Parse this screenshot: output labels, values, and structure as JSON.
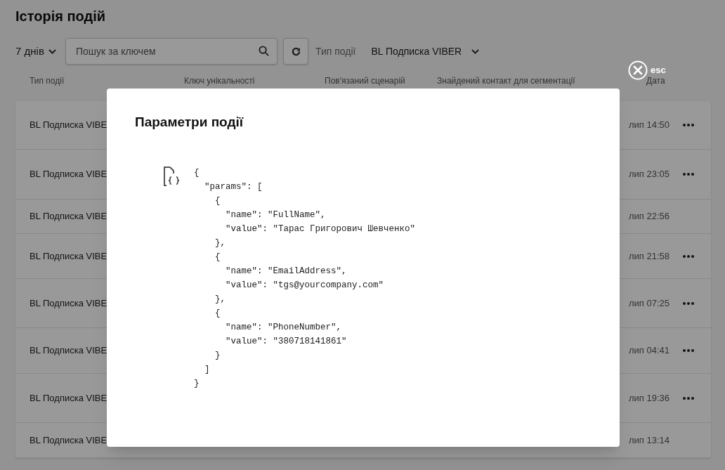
{
  "page": {
    "title": "Історія подій"
  },
  "toolbar": {
    "period": "7 днів",
    "search": {
      "placeholder": "Пошук за ключем"
    },
    "event_type_label": "Тип події",
    "event_type_value": "BL Подписка VIBER"
  },
  "table": {
    "columns": [
      "Тип події",
      "Ключ унікальності",
      "Пов'язаний сценарій",
      "Знайдений контакт для сегментації",
      "Дата"
    ],
    "rows": [
      {
        "event_type": "BL Подписка VIBE",
        "date": "лип 14:50",
        "menu": true
      },
      {
        "event_type": "BL Подписка VIBE",
        "date": "лип 23:05",
        "menu": true
      },
      {
        "event_type": "BL Подписка VIBE",
        "date": "лип 22:56",
        "menu": false
      },
      {
        "event_type": "BL Подписка VIBE",
        "date": "лип 21:58",
        "menu": true
      },
      {
        "event_type": "BL Подписка VIBE",
        "date": "лип 07:25",
        "menu": true
      },
      {
        "event_type": "BL Подписка VIBE",
        "date": "лип 04:41",
        "menu": true
      },
      {
        "event_type": "BL Подписка VIBE",
        "date": "лип 19:36",
        "menu": true
      },
      {
        "event_type": "BL Подписка VIBE",
        "date": "лип 13:14",
        "menu": false
      }
    ]
  },
  "modal": {
    "title": "Параметри події",
    "close_label": "esc",
    "json": "{\n  \"params\": [\n    {\n      \"name\": \"FullName\",\n      \"value\": \"Тарас Григорович Шевченко\"\n    },\n    {\n      \"name\": \"EmailAddress\",\n      \"value\": \"tgs@yourcompany.com\"\n    },\n    {\n      \"name\": \"PhoneNumber\",\n      \"value\": \"380718141861\"\n    }\n  ]\n}"
  }
}
